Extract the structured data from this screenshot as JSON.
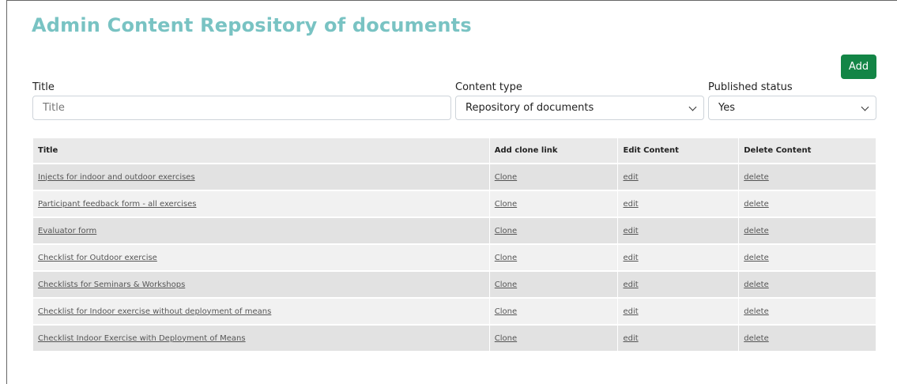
{
  "page": {
    "title": "Admin Content Repository of documents"
  },
  "toolbar": {
    "add_label": "Add"
  },
  "filters": {
    "title_label": "Title",
    "title_placeholder": "Title",
    "title_value": "",
    "content_type_label": "Content type",
    "content_type_value": "Repository of documents",
    "published_label": "Published status",
    "published_value": "Yes"
  },
  "table": {
    "headers": [
      "Title",
      "Add clone link",
      "Edit Content",
      "Delete Content"
    ],
    "rows": [
      {
        "title": "Injects for indoor and outdoor exercises",
        "clone": "Clone",
        "edit": "edit",
        "delete": "delete"
      },
      {
        "title": "Participant feedback form - all exercises",
        "clone": "Clone",
        "edit": "edit",
        "delete": "delete"
      },
      {
        "title": "Evaluator form",
        "clone": "Clone",
        "edit": "edit",
        "delete": "delete"
      },
      {
        "title": "Checklist for Outdoor exercise",
        "clone": "Clone",
        "edit": "edit",
        "delete": "delete"
      },
      {
        "title": "Checklists for Seminars & Workshops",
        "clone": "Clone",
        "edit": "edit",
        "delete": "delete"
      },
      {
        "title": "Checklist for Indoor exercise without deployment of means",
        "clone": "Clone",
        "edit": "edit",
        "delete": "delete"
      },
      {
        "title": "Checklist Indoor Exercise with Deployment of Means",
        "clone": "Clone",
        "edit": "edit",
        "delete": "delete"
      }
    ]
  },
  "colors": {
    "title": "#79c3c3",
    "add_button": "#138546",
    "row_odd": "#e2e2e2",
    "row_even": "#f1f1f1"
  }
}
